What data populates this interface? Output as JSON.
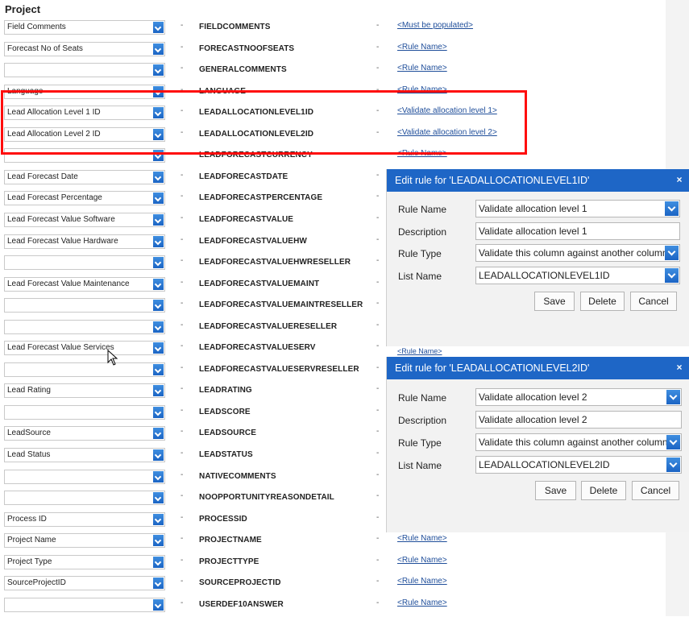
{
  "section_title": "Project",
  "separator": "-",
  "rows": [
    {
      "select": "Field Comments",
      "column": "FIELDCOMMENTS",
      "rule": "<Must be populated>"
    },
    {
      "select": "Forecast No of Seats",
      "column": "FORECASTNOOFSEATS",
      "rule": "<Rule Name>"
    },
    {
      "select": "",
      "column": "GENERALCOMMENTS",
      "rule": "<Rule Name>"
    },
    {
      "select": "Language",
      "column": "LANGUAGE",
      "rule": "<Rule Name>"
    },
    {
      "select": "Lead Allocation Level 1 ID",
      "column": "LEADALLOCATIONLEVEL1ID",
      "rule": "<Validate allocation level 1>"
    },
    {
      "select": "Lead Allocation Level 2 ID",
      "column": "LEADALLOCATIONLEVEL2ID",
      "rule": "<Validate allocation level 2>"
    },
    {
      "select": "",
      "column": "LEADFORECASTCURRENCY",
      "rule": "<Rule Name>"
    },
    {
      "select": "Lead Forecast Date",
      "column": "LEADFORECASTDATE",
      "rule": ""
    },
    {
      "select": "Lead Forecast Percentage",
      "column": "LEADFORECASTPERCENTAGE",
      "rule": ""
    },
    {
      "select": "Lead Forecast Value Software",
      "column": "LEADFORECASTVALUE",
      "rule": ""
    },
    {
      "select": "Lead Forecast Value Hardware",
      "column": "LEADFORECASTVALUEHW",
      "rule": ""
    },
    {
      "select": "",
      "column": "LEADFORECASTVALUEHWRESELLER",
      "rule": ""
    },
    {
      "select": "Lead Forecast Value Maintenance",
      "column": "LEADFORECASTVALUEMAINT",
      "rule": ""
    },
    {
      "select": "",
      "column": "LEADFORECASTVALUEMAINTRESELLER",
      "rule": ""
    },
    {
      "select": "",
      "column": "LEADFORECASTVALUERESELLER",
      "rule": ""
    },
    {
      "select": "Lead Forecast Value Services",
      "column": "LEADFORECASTVALUESERV",
      "rule": ""
    },
    {
      "select": "",
      "column": "LEADFORECASTVALUESERVRESELLER",
      "rule": ""
    },
    {
      "select": "Lead Rating",
      "column": "LEADRATING",
      "rule": ""
    },
    {
      "select": "",
      "column": "LEADSCORE",
      "rule": ""
    },
    {
      "select": "LeadSource",
      "column": "LEADSOURCE",
      "rule": ""
    },
    {
      "select": "Lead Status",
      "column": "LEADSTATUS",
      "rule": ""
    },
    {
      "select": "",
      "column": "NATIVECOMMENTS",
      "rule": ""
    },
    {
      "select": "",
      "column": "NOOPPORTUNITYREASONDETAIL",
      "rule": ""
    },
    {
      "select": "Process ID",
      "column": "PROCESSID",
      "rule": ""
    },
    {
      "select": "Project Name",
      "column": "PROJECTNAME",
      "rule": "<Rule Name>"
    },
    {
      "select": "Project Type",
      "column": "PROJECTTYPE",
      "rule": "<Rule Name>"
    },
    {
      "select": "SourceProjectID",
      "column": "SOURCEPROJECTID",
      "rule": "<Rule Name>"
    },
    {
      "select": "",
      "column": "USERDEF10ANSWER",
      "rule": "<Rule Name>"
    }
  ],
  "gap_link": "<Rule Name>",
  "dialogs": [
    {
      "title": "Edit rule for 'LEADALLOCATIONLEVEL1ID'",
      "close": "×",
      "labels": {
        "rule_name": "Rule Name",
        "description": "Description",
        "rule_type": "Rule Type",
        "list_name": "List Name"
      },
      "values": {
        "rule_name": "Validate allocation level 1",
        "description": "Validate allocation level 1",
        "rule_type": "Validate this column against another column",
        "list_name": "LEADALLOCATIONLEVEL1ID"
      },
      "buttons": {
        "save": "Save",
        "delete": "Delete",
        "cancel": "Cancel"
      }
    },
    {
      "title": "Edit rule for 'LEADALLOCATIONLEVEL2ID'",
      "close": "×",
      "labels": {
        "rule_name": "Rule Name",
        "description": "Description",
        "rule_type": "Rule Type",
        "list_name": "List Name"
      },
      "values": {
        "rule_name": "Validate allocation level 2",
        "description": "Validate allocation level 2",
        "rule_type": "Validate this column against another column",
        "list_name": "LEADALLOCATIONLEVEL2ID"
      },
      "buttons": {
        "save": "Save",
        "delete": "Delete",
        "cancel": "Cancel"
      }
    }
  ]
}
